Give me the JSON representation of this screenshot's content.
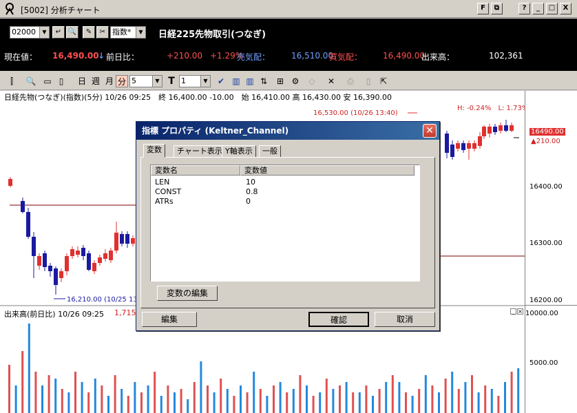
{
  "window": {
    "title": "[5002] 分析チャート",
    "buttons": [
      "F",
      "⧉",
      "?",
      "_",
      "□",
      "X"
    ]
  },
  "panel": {
    "code_value": "02000",
    "index_select": "指数*",
    "product_name": "日経225先物取引(つなぎ)",
    "quote": {
      "current_label": "現在値：",
      "current_value": "16,490.00",
      "current_arrow": "↓",
      "prev_label": "前日比：",
      "change_value": "+210.00",
      "change_pct": "+1.29%",
      "ask_label": "売気配：",
      "ask_value": "16,510.00",
      "bid_label": "買気配：",
      "bid_value": "16,490.00",
      "volume_label": "出来高：",
      "volume_value": "102,361"
    }
  },
  "toolbar": {
    "day": "日",
    "week": "週",
    "month": "月",
    "minute": "分",
    "interval": "5",
    "t_label": "T",
    "t_value": "1"
  },
  "chart": {
    "info_line": "日経先物(つなぎ)(指数)(5分) 10/26 09:25　終 16,400.00 -10.00　始 16,410.00 高 16,430.00 安 16,390.00",
    "high_note": "16,530.00 (10/26 13:40)",
    "low_note": "16,210.00 (10/25 13",
    "hl_note": "H: -0.24%　L: 1.73%",
    "price_tag": "16490.00",
    "price_change_tag": "▲210.00",
    "axis_labels": [
      "16400.00",
      "16300.00",
      "16200.00"
    ],
    "volume_info_label": "出来高(前日比) 10/26 09:25",
    "volume_info_value": "1,715.00",
    "volume_axis": [
      "10000.00",
      "5000.00"
    ]
  },
  "dialog": {
    "title": "指標 プロパティ (Keltner_Channel)",
    "tabs": [
      "変数",
      "チャート表示",
      "Y軸表示",
      "一般"
    ],
    "columns": [
      "変数名",
      "変数値"
    ],
    "rows": [
      {
        "name": "LEN",
        "value": "10"
      },
      {
        "name": "CONST",
        "value": "0.8"
      },
      {
        "name": "ATRs",
        "value": "0"
      }
    ],
    "edit_vars_button": "変数の編集",
    "edit_button": "編集",
    "ok_button": "確認",
    "cancel_button": "取消"
  },
  "chart_data": {
    "type": "candlestick",
    "bull_color": "#e03030",
    "bear_color": "#1a1aa0",
    "volume_colors": [
      "#e05050",
      "#2288dd"
    ]
  }
}
